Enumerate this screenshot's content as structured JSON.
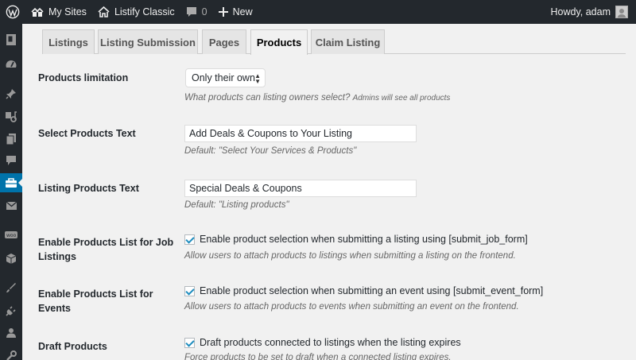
{
  "adminbar": {
    "my_sites": "My Sites",
    "site_name": "Listify Classic",
    "comments_count": "0",
    "new_label": "New",
    "howdy": "Howdy, adam"
  },
  "sidebar": {
    "icons": [
      "wp-logo-icon",
      "dashboard-icon",
      "pin-icon",
      "media-icon",
      "pages-icon",
      "comments-icon",
      "listings-icon",
      "mail-icon",
      "woocommerce-icon",
      "products-icon",
      "appearance-icon",
      "plugins-icon",
      "users-icon",
      "tools-icon"
    ],
    "active": "listings-icon"
  },
  "tabs": [
    {
      "label": "Listings",
      "active": false
    },
    {
      "label": "Listing Submission",
      "active": false
    },
    {
      "label": "Pages",
      "active": false
    },
    {
      "label": "Products",
      "active": true
    },
    {
      "label": "Claim Listing",
      "active": false
    }
  ],
  "settings": {
    "products_limitation": {
      "label": "Products limitation",
      "value": "Only their own",
      "desc": "What products can listing owners select?",
      "desc_small": "Admins will see all products"
    },
    "select_products_text": {
      "label": "Select Products Text",
      "value": "Add Deals & Coupons to Your Listing",
      "desc": "Default: \"Select Your Services & Products\""
    },
    "listing_products_text": {
      "label": "Listing Products Text",
      "value": "Special Deals & Coupons",
      "desc": "Default: \"Listing products\""
    },
    "enable_job_listings": {
      "label": "Enable Products List for Job Listings",
      "checkbox_label": "Enable product selection when submitting a listing using [submit_job_form]",
      "checked": true,
      "desc": "Allow users to attach products to listings when submitting a listing on the frontend."
    },
    "enable_events": {
      "label": "Enable Products List for Events",
      "checkbox_label": "Enable product selection when submitting an event using [submit_event_form]",
      "checked": true,
      "desc": "Allow users to attach products to events when submitting an event on the frontend."
    },
    "draft_products": {
      "label": "Draft Products",
      "checkbox_label": "Draft products connected to listings when the listing expires",
      "checked": true,
      "desc": "Force products to be set to draft when a connected listing expires."
    }
  },
  "colors": {
    "adminbar_bg": "#23282d",
    "accent": "#0073aa",
    "page_bg": "#f1f1f1"
  }
}
